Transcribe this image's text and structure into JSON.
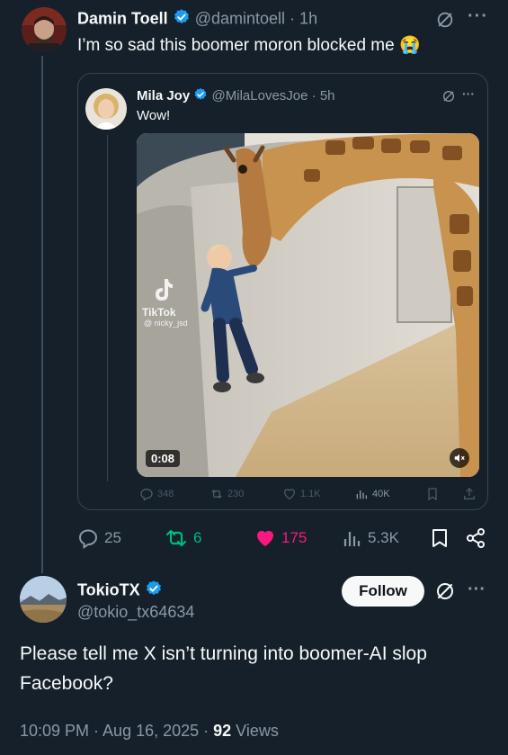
{
  "tweet": {
    "author_name": "Damin Toell",
    "handle": "@damintoell",
    "time": "· 1h",
    "text": "I’m so sad this boomer moron blocked me 😭",
    "more": "···",
    "actions": {
      "replies": "25",
      "reposts": "6",
      "likes": "175",
      "views": "5.3K"
    }
  },
  "quote": {
    "author_name": "Mila Joy",
    "handle": "@MilaLovesJoe",
    "time": "· 5h",
    "text": "Wow!",
    "more": "···",
    "video": {
      "duration": "0:08",
      "watermark_brand": "TikTok",
      "watermark_user": "@ nicky_jsd"
    },
    "actions": {
      "replies": "348",
      "reposts": "230",
      "likes": "1.1K",
      "views": "40K"
    }
  },
  "reply": {
    "author_name": "TokioTX",
    "handle": "@tokio_tx64634",
    "follow_label": "Follow",
    "more": "···",
    "text_line1": "Please tell me X isn’t turning into boomer-AI slop",
    "text_line2": "Facebook?",
    "timestamp": "10:09 PM · Aug 16, 2025 · ",
    "views_count": "92",
    "views_label": " Views"
  },
  "colors": {
    "background": "#15202b",
    "text": "#f7f9f9",
    "muted": "#8b98a5",
    "verified": "#1d9bf0",
    "like": "#f91880",
    "repost": "#00ba7c"
  }
}
